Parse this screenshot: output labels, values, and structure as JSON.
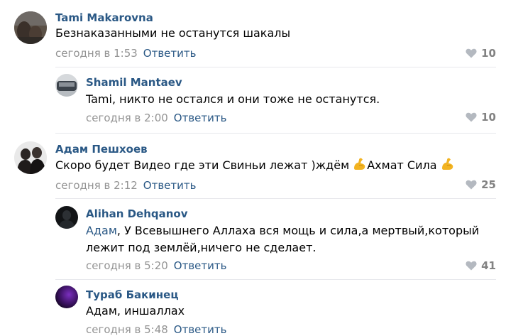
{
  "comments": [
    {
      "author": "Tami Makarovna",
      "text": "Безнаказанными не останутся шакалы",
      "date": "сегодня в 1:53",
      "reply_label": "Ответить",
      "likes": "10"
    },
    {
      "author": "Shamil Mantaev",
      "text": "Tami, никто не остался и они тоже не останутся.",
      "date": "сегодня в 2:00",
      "reply_label": "Ответить",
      "likes": "10"
    },
    {
      "author": "Адам Пешхоев",
      "text_before": "Скоро будет Видео где эти Свиньи лежат )ждём ",
      "text_middle": "Ахмат Сила ",
      "date": "сегодня в 2:12",
      "reply_label": "Ответить",
      "likes": "25"
    },
    {
      "author": "Alihan Dehqanov",
      "mention": "Адам",
      "text_line1": ", У Всевышнего Аллаха вся мощь и сила,а мертвый,который",
      "text_line2": "лежит под землёй,ничего не сделает.",
      "date": "сегодня в 5:20",
      "reply_label": "Ответить",
      "likes": "41"
    },
    {
      "author": "Тураб Бакинец",
      "text": "Адам, иншаллах",
      "date": "сегодня в 5:48",
      "reply_label": "Ответить"
    }
  ],
  "icons": {
    "like": "heart-icon",
    "emoji": "flexed-biceps-emoji"
  },
  "colors": {
    "link": "#2a5885",
    "meta": "#939393",
    "likes": "#828282",
    "divider": "#e7e8ec"
  }
}
